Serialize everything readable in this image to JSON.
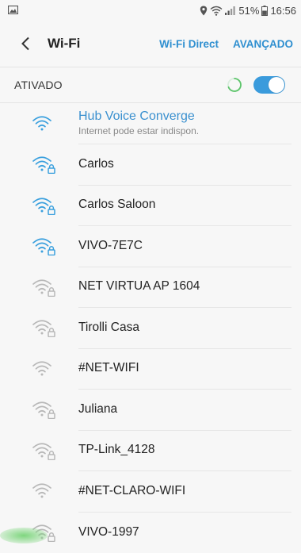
{
  "status_bar": {
    "battery": "51%",
    "time": "16:56",
    "icons": [
      "image-icon",
      "location-icon",
      "wifi-icon",
      "signal-icon",
      "battery-icon"
    ]
  },
  "header": {
    "back_icon": "chevron-left-icon",
    "title": "Wi-Fi",
    "wifi_direct": "Wi-Fi Direct",
    "advanced": "AVANÇADO"
  },
  "toggle": {
    "label": "ATIVADO",
    "state": "on"
  },
  "colors": {
    "accent": "#3a90cf",
    "signal_strong": "#3aa0de",
    "signal_weak": "#b8b8b8"
  },
  "networks": [
    {
      "name": "Hub Voice Converge",
      "status": "Internet pode estar indispon.",
      "secured": false,
      "strength": "strong",
      "connected": true
    },
    {
      "name": "Carlos",
      "status": "",
      "secured": true,
      "strength": "strong",
      "connected": false
    },
    {
      "name": "Carlos Saloon",
      "status": "",
      "secured": true,
      "strength": "strong",
      "connected": false
    },
    {
      "name": "VIVO-7E7C",
      "status": "",
      "secured": true,
      "strength": "strong",
      "connected": false
    },
    {
      "name": "NET VIRTUA AP 1604",
      "status": "",
      "secured": true,
      "strength": "weak",
      "connected": false
    },
    {
      "name": "Tirolli Casa",
      "status": "",
      "secured": true,
      "strength": "weak",
      "connected": false
    },
    {
      "name": "#NET-WIFI",
      "status": "",
      "secured": false,
      "strength": "weak",
      "connected": false
    },
    {
      "name": "Juliana",
      "status": "",
      "secured": true,
      "strength": "weak",
      "connected": false
    },
    {
      "name": "TP-Link_4128",
      "status": "",
      "secured": true,
      "strength": "weak",
      "connected": false
    },
    {
      "name": "#NET-CLARO-WIFI",
      "status": "",
      "secured": false,
      "strength": "weak",
      "connected": false
    },
    {
      "name": "VIVO-1997",
      "status": "",
      "secured": true,
      "strength": "weak",
      "connected": false
    }
  ]
}
